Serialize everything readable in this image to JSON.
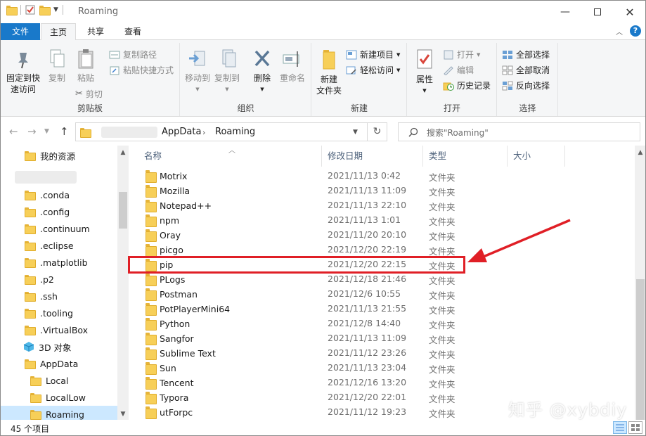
{
  "window": {
    "title": "Roaming"
  },
  "tabs": {
    "file": "文件",
    "home": "主页",
    "share": "共享",
    "view": "查看"
  },
  "ribbon": {
    "clipboard": {
      "label": "剪贴板",
      "pin": "固定到快速访问",
      "pin_line1": "固定到快",
      "pin_line2": "速访问",
      "copy": "复制",
      "paste": "粘贴",
      "copy_path": "复制路径",
      "paste_shortcut": "粘贴快捷方式",
      "cut": "剪切"
    },
    "organize": {
      "label": "组织",
      "move_to": "移动到",
      "copy_to": "复制到",
      "delete": "删除",
      "rename": "重命名"
    },
    "new": {
      "label": "新建",
      "new_folder_line1": "新建",
      "new_folder_line2": "文件夹",
      "new_item": "新建项目",
      "easy_access": "轻松访问"
    },
    "open": {
      "label": "打开",
      "properties": "属性",
      "open": "打开",
      "edit": "编辑",
      "history": "历史记录"
    },
    "select": {
      "label": "选择",
      "select_all": "全部选择",
      "select_none": "全部取消",
      "invert": "反向选择"
    }
  },
  "address": {
    "crumb1": "AppData",
    "crumb2": "Roaming"
  },
  "search": {
    "placeholder": "搜索\"Roaming\""
  },
  "nav": {
    "items": [
      {
        "label": "我的资源"
      },
      {
        "label": ".conda"
      },
      {
        "label": ".config"
      },
      {
        "label": ".continuum"
      },
      {
        "label": ".eclipse"
      },
      {
        "label": ".matplotlib"
      },
      {
        "label": ".p2"
      },
      {
        "label": ".ssh"
      },
      {
        "label": ".tooling"
      },
      {
        "label": ".VirtualBox"
      },
      {
        "label": "3D 对象"
      },
      {
        "label": "AppData"
      },
      {
        "label": "Local"
      },
      {
        "label": "LocalLow"
      },
      {
        "label": "Roaming"
      }
    ]
  },
  "columns": {
    "name": "名称",
    "date": "修改日期",
    "type": "类型",
    "size": "大小"
  },
  "files": [
    {
      "name": "Motrix",
      "date": "2021/11/13 0:42",
      "type": "文件夹"
    },
    {
      "name": "Mozilla",
      "date": "2021/11/13 11:09",
      "type": "文件夹"
    },
    {
      "name": "Notepad++",
      "date": "2021/11/13 22:10",
      "type": "文件夹"
    },
    {
      "name": "npm",
      "date": "2021/11/13 1:01",
      "type": "文件夹"
    },
    {
      "name": "Oray",
      "date": "2021/11/20 20:10",
      "type": "文件夹"
    },
    {
      "name": "picgo",
      "date": "2021/12/20 22:19",
      "type": "文件夹"
    },
    {
      "name": "pip",
      "date": "2021/12/20 22:15",
      "type": "文件夹"
    },
    {
      "name": "PLogs",
      "date": "2021/12/18 21:46",
      "type": "文件夹"
    },
    {
      "name": "Postman",
      "date": "2021/12/6 10:55",
      "type": "文件夹"
    },
    {
      "name": "PotPlayerMini64",
      "date": "2021/11/13 21:55",
      "type": "文件夹"
    },
    {
      "name": "Python",
      "date": "2021/12/8 14:40",
      "type": "文件夹"
    },
    {
      "name": "Sangfor",
      "date": "2021/11/13 11:09",
      "type": "文件夹"
    },
    {
      "name": "Sublime Text",
      "date": "2021/11/12 23:26",
      "type": "文件夹"
    },
    {
      "name": "Sun",
      "date": "2021/11/13 23:04",
      "type": "文件夹"
    },
    {
      "name": "Tencent",
      "date": "2021/12/16 13:20",
      "type": "文件夹"
    },
    {
      "name": "Typora",
      "date": "2021/12/20 22:01",
      "type": "文件夹"
    },
    {
      "name": "utForpc",
      "date": "2021/11/12 19:23",
      "type": "文件夹"
    }
  ],
  "status": {
    "count": "45 个项目"
  },
  "watermark": "知乎 @xybdiy",
  "colors": {
    "accent": "#1979ca",
    "highlight": "#e01f26",
    "folder": "#f7cf58",
    "selection": "#cce8ff"
  }
}
